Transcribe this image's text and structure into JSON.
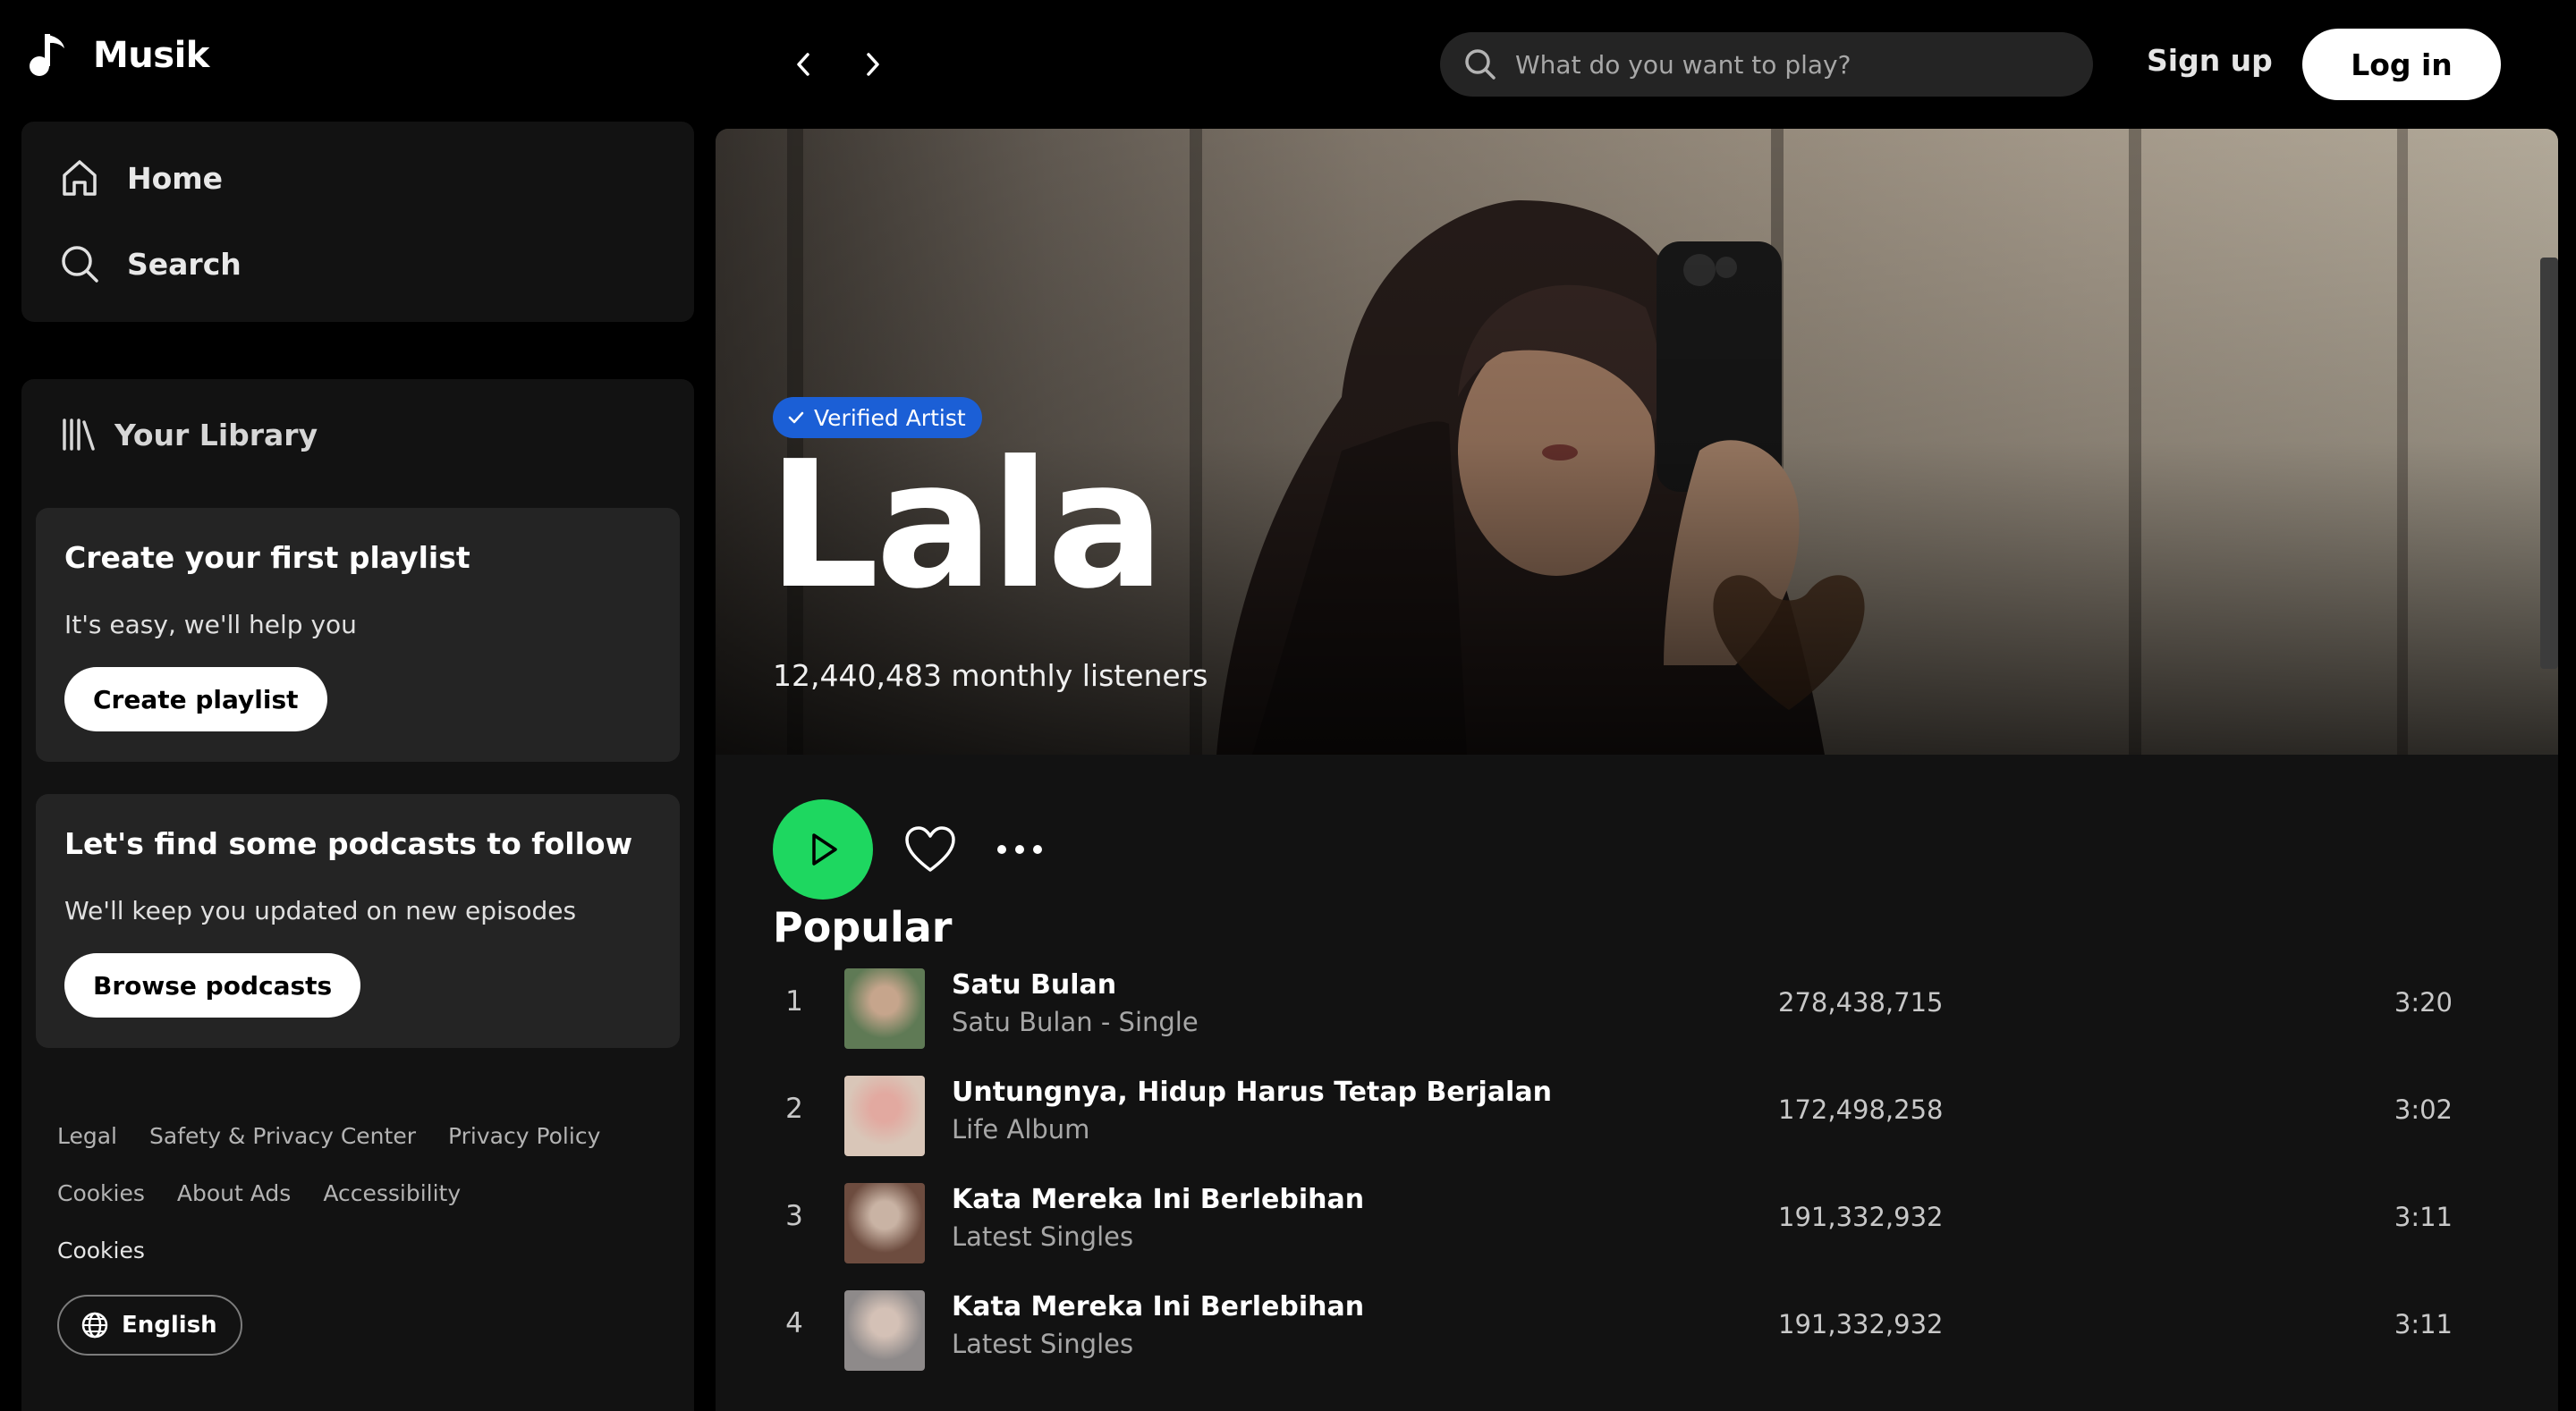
{
  "brand": {
    "name": "Musik"
  },
  "header": {
    "search_placeholder": "What do you want to play?",
    "signup_label": "Sign up",
    "login_label": "Log in"
  },
  "nav": {
    "home_label": "Home",
    "search_label": "Search"
  },
  "library": {
    "title": "Your Library",
    "playlist_card": {
      "title": "Create your first playlist",
      "subtitle": "It's easy, we'll help you",
      "button": "Create playlist"
    },
    "podcast_card": {
      "title": "Let's find some podcasts to follow",
      "subtitle": "We'll keep you updated on new episodes",
      "button": "Browse podcasts"
    }
  },
  "footer": {
    "links_row1": [
      "Legal",
      "Safety & Privacy Center",
      "Privacy Policy"
    ],
    "links_row2": [
      "Cookies",
      "About Ads",
      "Accessibility"
    ],
    "links_row3": [
      "Cookies"
    ],
    "language": "English"
  },
  "artist": {
    "badge": "Verified Artist",
    "name": "Lala",
    "listeners": "12,440,483 monthly listeners"
  },
  "popular": {
    "heading": "Popular",
    "tracks": [
      {
        "num": "1",
        "title": "Satu Bulan",
        "album": "Satu Bulan - Single",
        "plays": "278,438,715",
        "duration": "3:20",
        "art_colors": [
          "#5f7a55",
          "#c6a58c"
        ]
      },
      {
        "num": "2",
        "title": "Untungnya, Hidup Harus Tetap Berjalan",
        "album": "Life Album",
        "plays": "172,498,258",
        "duration": "3:02",
        "art_colors": [
          "#d9c6b8",
          "#e2a9a0"
        ]
      },
      {
        "num": "3",
        "title": "Kata Mereka Ini Berlebihan",
        "album": "Latest Singles",
        "plays": "191,332,932",
        "duration": "3:11",
        "art_colors": [
          "#6d4c3f",
          "#c9b3a4"
        ]
      },
      {
        "num": "4",
        "title": "Kata Mereka Ini Berlebihan",
        "album": "Latest Singles",
        "plays": "191,332,932",
        "duration": "3:11",
        "art_colors": [
          "#8e8a8a",
          "#d4c1b6"
        ]
      }
    ]
  },
  "colors": {
    "accent": "#1ed760",
    "badge": "#1b5fd6",
    "panel": "#121212",
    "card": "#242424"
  }
}
